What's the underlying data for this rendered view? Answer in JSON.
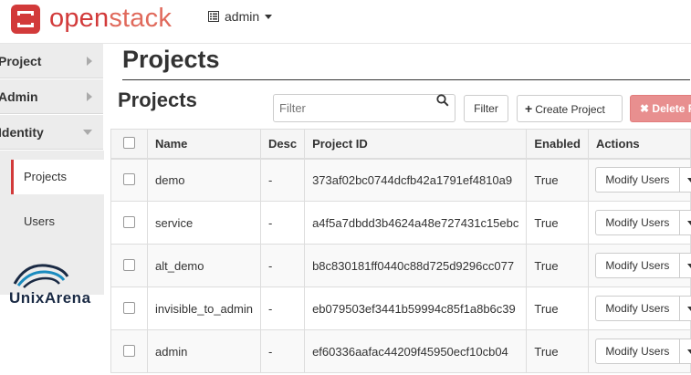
{
  "brand": {
    "part1": "open",
    "part2": "stack"
  },
  "project_menu": {
    "label": "admin"
  },
  "sidebar": {
    "sections": [
      {
        "label": "Project"
      },
      {
        "label": "Admin"
      },
      {
        "label": "Identity"
      }
    ],
    "identity_items": [
      {
        "label": "Projects",
        "active": true
      },
      {
        "label": "Users",
        "active": false
      }
    ]
  },
  "watermark": {
    "text": "UnixArena"
  },
  "page": {
    "title": "Projects",
    "section_title": "Projects"
  },
  "toolbar": {
    "filter_placeholder": "Filter",
    "filter_button": "Filter",
    "create_button": "Create Project",
    "delete_button": "Delete P"
  },
  "table": {
    "headers": {
      "name": "Name",
      "desc": "Desc",
      "id": "Project ID",
      "enabled": "Enabled",
      "actions": "Actions"
    },
    "rows": [
      {
        "name": "demo",
        "desc": "-",
        "id": "373af02bc0744dcfb42a1791ef4810a9",
        "enabled": "True",
        "action": "Modify Users"
      },
      {
        "name": "service",
        "desc": "-",
        "id": "a4f5a7dbdd3b4624a48e727431c15ebc",
        "enabled": "True",
        "action": "Modify Users"
      },
      {
        "name": "alt_demo",
        "desc": "-",
        "id": "b8c830181ff0440c88d725d9296cc077",
        "enabled": "True",
        "action": "Modify Users"
      },
      {
        "name": "invisible_to_admin",
        "desc": "-",
        "id": "eb079503ef3441b59994c85f1a8b6c39",
        "enabled": "True",
        "action": "Modify Users"
      },
      {
        "name": "admin",
        "desc": "-",
        "id": "ef60336aafac44209f45950ecf10cb04",
        "enabled": "True",
        "action": "Modify Users"
      }
    ]
  },
  "colors": {
    "brand_red": "#d23a3a",
    "delete_bg": "#e88f8f"
  }
}
